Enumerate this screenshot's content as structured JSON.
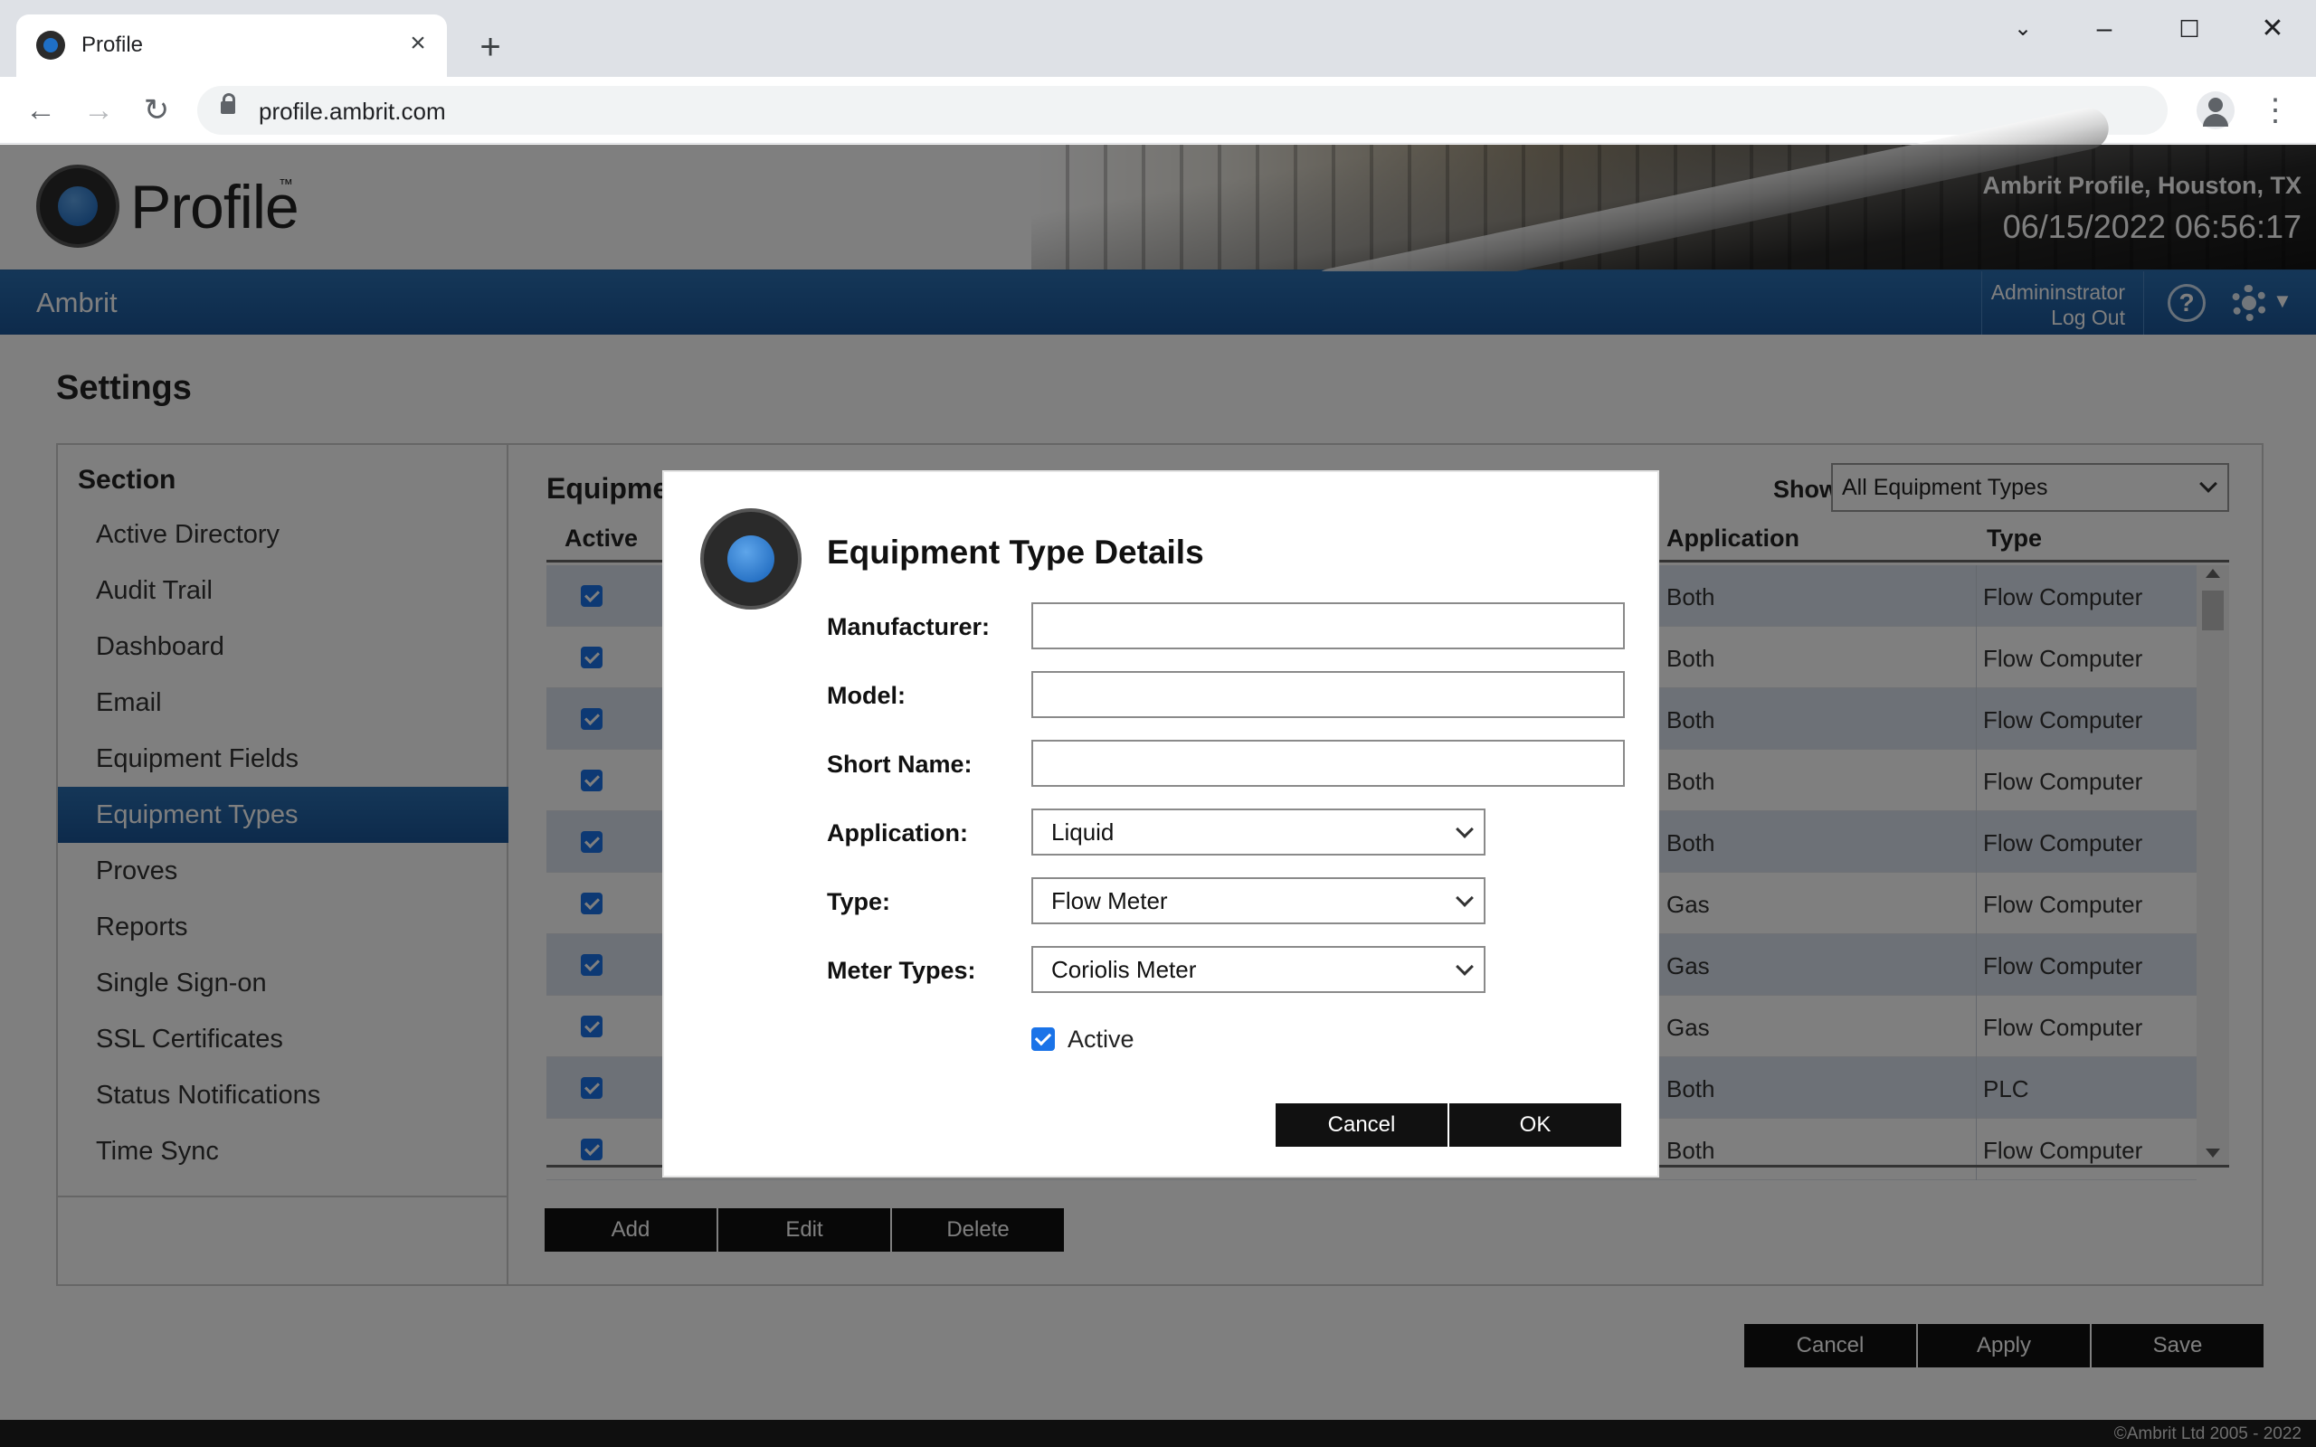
{
  "browser": {
    "tab_title": "Profile",
    "url": "profile.ambrit.com"
  },
  "header": {
    "logo_text": "Profile",
    "logo_tm": "™",
    "site_name": "Ambrit Profile, Houston, TX",
    "datetime": "06/15/2022 06:56:17"
  },
  "nav": {
    "brand": "Ambrit",
    "user": "Admininstrator",
    "logout": "Log Out",
    "help": "?"
  },
  "page": {
    "title": "Settings",
    "section_heading": "Section",
    "sidebar": [
      {
        "label": "Active Directory"
      },
      {
        "label": "Audit Trail"
      },
      {
        "label": "Dashboard"
      },
      {
        "label": "Email"
      },
      {
        "label": "Equipment Fields"
      },
      {
        "label": "Equipment Types",
        "active": true
      },
      {
        "label": "Proves"
      },
      {
        "label": "Reports"
      },
      {
        "label": "Single Sign-on"
      },
      {
        "label": "SSL Certificates"
      },
      {
        "label": "Status Notifications"
      },
      {
        "label": "Time Sync"
      }
    ],
    "main_heading": "Equipme",
    "show_label": "Show:",
    "show_value": "All Equipment Types",
    "columns": {
      "active": "Active",
      "application": "Application",
      "type": "Type"
    },
    "rows": [
      {
        "active": true,
        "application": "Both",
        "type": "Flow Computer"
      },
      {
        "active": true,
        "application": "Both",
        "type": "Flow Computer"
      },
      {
        "active": true,
        "application": "Both",
        "type": "Flow Computer"
      },
      {
        "active": true,
        "application": "Both",
        "type": "Flow Computer"
      },
      {
        "active": true,
        "application": "Both",
        "type": "Flow Computer"
      },
      {
        "active": true,
        "application": "Gas",
        "type": "Flow Computer"
      },
      {
        "active": true,
        "application": "Gas",
        "type": "Flow Computer"
      },
      {
        "active": true,
        "application": "Gas",
        "type": "Flow Computer"
      },
      {
        "active": true,
        "application": "Both",
        "type": "PLC"
      },
      {
        "active": true,
        "application": "Both",
        "type": "Flow Computer"
      }
    ],
    "grid_buttons": {
      "add": "Add",
      "edit": "Edit",
      "delete": "Delete"
    },
    "footer_buttons": {
      "cancel": "Cancel",
      "apply": "Apply",
      "save": "Save"
    },
    "copyright": "©Ambrit Ltd 2005 - 2022"
  },
  "modal": {
    "title": "Equipment Type Details",
    "manufacturer_label": "Manufacturer:",
    "manufacturer_value": "",
    "model_label": "Model:",
    "model_value": "",
    "short_name_label": "Short Name:",
    "short_name_value": "",
    "application_label": "Application:",
    "application_value": "Liquid",
    "type_label": "Type:",
    "type_value": "Flow Meter",
    "meter_types_label": "Meter Types:",
    "meter_types_value": "Coriolis Meter",
    "active_label": "Active",
    "active_checked": true,
    "cancel": "Cancel",
    "ok": "OK"
  },
  "colors": {
    "accent_blue": "#1a5597",
    "checkbox_blue": "#1a73e8",
    "button_dark": "#111111"
  }
}
